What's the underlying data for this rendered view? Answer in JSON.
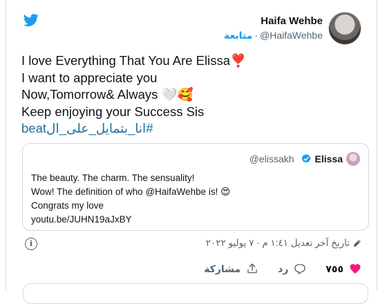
{
  "colors": {
    "accent": "#1d9bf0",
    "like": "#f91880",
    "muted": "#536471",
    "text": "#0f1419"
  },
  "author": {
    "display_name": "Haifa Wehbe",
    "handle": "@HaifaWehbe",
    "follow_label": "متابعة",
    "separator": "·"
  },
  "tweet": {
    "lines": [
      "I love Everything That You Are Elissa❣️",
      "I want to appreciate you",
      "Now,Tomorrow& Always 🤍🥰",
      "Keep enjoying your Success Sis"
    ],
    "hashtag": "#انا_بتمايل_على_الbeat"
  },
  "quoted": {
    "name": "Elissa",
    "handle": "@elissakh",
    "lines": [
      "The beauty. The charm. The sensuality!",
      "Wow! The definition of who @HaifaWehbe is! 😍",
      "Congrats my love",
      "youtu.be/JUHN19aJxBY"
    ]
  },
  "timestamp": "تاريخ آخر تعديل ١:٤١ م · ٧ يوليو ٢٠٢٢",
  "actions": {
    "like_count": "٧٥٥",
    "reply_label": "رد",
    "share_label": "مشاركة"
  },
  "icons": [
    "twitter-logo-icon",
    "verified-icon",
    "info-icon",
    "pencil-icon",
    "heart-icon",
    "reply-icon",
    "share-icon"
  ]
}
